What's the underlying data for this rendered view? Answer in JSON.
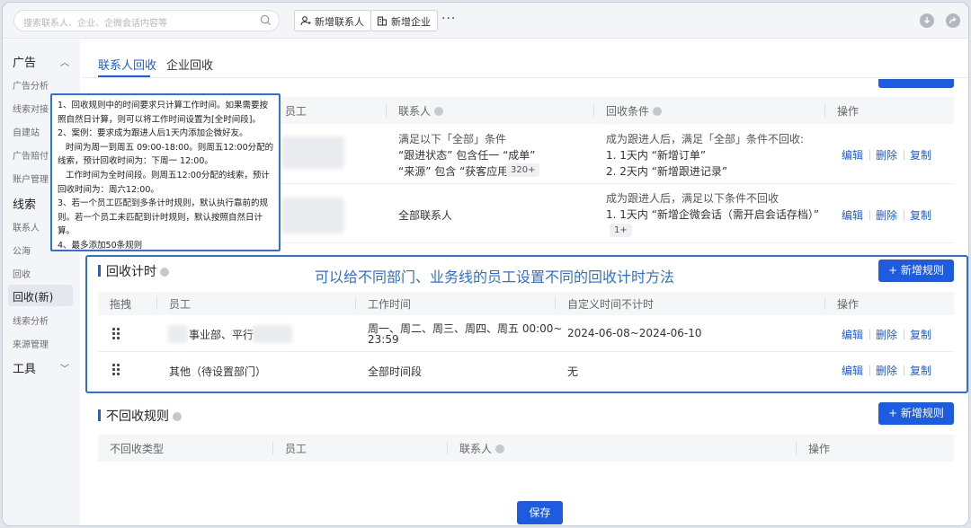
{
  "topbar": {
    "search_placeholder": "搜索联系人、企业、企微会话内容等",
    "btn_add_contact": "新增联系人",
    "btn_add_company": "新增企业",
    "more": "···"
  },
  "sidebar": {
    "groups": [
      {
        "label": "广告",
        "items": [
          "广告分析",
          "线索对接",
          "自建站",
          "广告赔付",
          "账户管理"
        ]
      },
      {
        "label": "线索",
        "items": [
          "联系人",
          "公海",
          "回收",
          "回收(新)",
          "线索分析",
          "来源管理"
        ]
      },
      {
        "label": "工具",
        "items": []
      }
    ],
    "active_item": "回收(新)"
  },
  "tabs": [
    "联系人回收",
    "企业回收"
  ],
  "rules_table": {
    "headers": [
      "员工",
      "联系人",
      "回收条件",
      "操作"
    ],
    "rows": [
      {
        "contact_lines": [
          "满足以下「全部」条件",
          "“跟进状态” 包含任一 “成单”",
          "“来源” 包含 “获客应用”"
        ],
        "contact_chip": "320+",
        "condition_lines": [
          "成为跟进人后，满足「全部」条件不回收:",
          "1. 1天内 “新增订单”",
          "2. 2天内 “新增跟进记录”"
        ]
      },
      {
        "contact_lines": [
          "全部联系人"
        ],
        "condition_lines": [
          "成为跟进人后，满足以下条件不回收",
          "1. 1天内 “新增企微会话（需开启会话存档）”"
        ],
        "condition_chip": "1+"
      }
    ],
    "actions": [
      "编辑",
      "删除",
      "复制"
    ]
  },
  "timing": {
    "title": "回收计时",
    "add_button": "+ 新增规则",
    "headers": [
      "拖拽",
      "员工",
      "工作时间",
      "自定义时间不计时",
      "操作"
    ],
    "rows": [
      {
        "employee": "事业部、平行",
        "work_time_1": "周一、周二、周三、周四、周五 00:00~",
        "work_time_2": "23:59",
        "custom": "2024-06-08~2024-06-10"
      },
      {
        "employee": "其他（待设置部门）",
        "work_time_1": "全部时间段",
        "work_time_2": "",
        "custom": "无"
      }
    ]
  },
  "no_recycle": {
    "title": "不回收规则",
    "add_button": "+ 新增规则",
    "headers": [
      "不回收类型",
      "员工",
      "联系人",
      "操作"
    ]
  },
  "save_button": "保存",
  "annotation": "可以给不同部门、业务线的员工设置不同的回收计时方法",
  "tooltip": [
    "1、回收规则中的时间要求只计算工作时间。如果需要按",
    "照自然日计算，则可以将工作时间设置为[全时间段]。",
    "2、案例：要求成为跟进人后1天内添加企微好友。",
    "   时间为周一到周五 09:00-18:00。则周五12:00分配的",
    "线索，预计回收时间为：下周一 12:00。",
    "   工作时间为全时间段。则周五12:00分配的线索，预计",
    "回收时间为：周六12:00。",
    "3、若一个员工匹配到多条计时规则，默认执行靠前的规",
    "则。若一个员工未匹配到计时规则，默认按照自然日计",
    "算。",
    "4、最多添加50条规则"
  ],
  "colors": {
    "primary": "#1d5ce0",
    "annotation": "#2f6fd6"
  }
}
